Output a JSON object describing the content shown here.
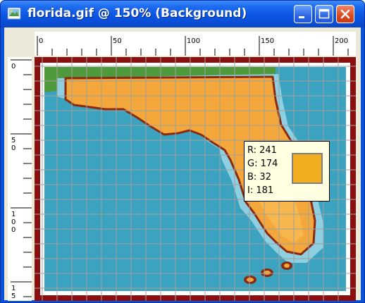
{
  "window": {
    "title": "florida.gif @ 150% (Background)",
    "app_icon": "image-document-icon",
    "controls": {
      "minimize": "minimize-icon",
      "maximize": "maximize-icon",
      "close": "close-icon"
    }
  },
  "ruler": {
    "horizontal_labels": [
      "0",
      "50",
      "100",
      "150",
      "200"
    ],
    "vertical_labels": [
      {
        "digits": [
          "0"
        ]
      },
      {
        "digits": [
          "5",
          "0"
        ]
      },
      {
        "digits": [
          "1",
          "0",
          "0"
        ]
      },
      {
        "digits": [
          "1",
          "5"
        ]
      }
    ]
  },
  "pixel_info": {
    "r": "R: 241",
    "g": "G: 174",
    "b": "B: 32",
    "i": "I: 181",
    "swatch_color": "#f1ae20"
  },
  "map": {
    "subject": "Florida",
    "colors": {
      "water": "#3ba3c0",
      "shallow_water": "#8ed0e2",
      "land": "#f4a73a",
      "land_light": "#f9c15a",
      "coast": "#8a2a10",
      "neighbor_land": "#4f9a3c",
      "frame_dark": "#8b0f0f",
      "frame_light": "#ffffff",
      "grid": "#a0a0a0"
    },
    "grid_visible": true
  }
}
